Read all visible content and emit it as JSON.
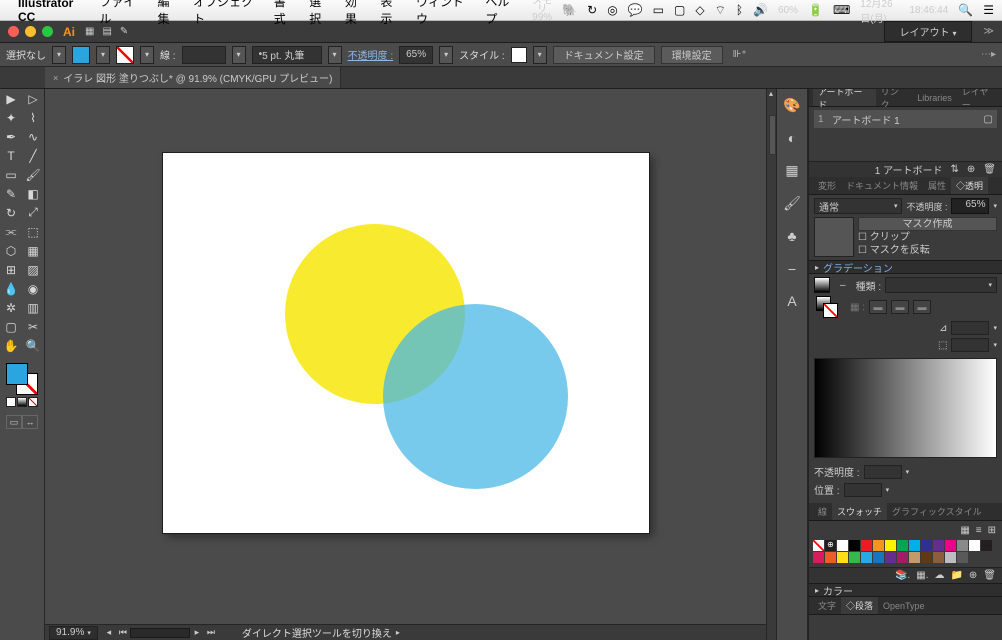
{
  "menubar": {
    "app": "Illustrator CC",
    "items": [
      "ファイル",
      "編集",
      "オブジェクト",
      "書式",
      "選択",
      "効果",
      "表示",
      "ウィンドウ",
      "ヘルプ"
    ],
    "mem_label": "メモリ",
    "mem_pct": "99%",
    "battery": "60%",
    "date": "12月26日(月)",
    "time": "18:46:44"
  },
  "appbar": {
    "layout_label": "レイアウト"
  },
  "controlbar": {
    "no_selection": "選択なし",
    "stroke_label": "線 :",
    "stroke_weight": "5 pt. 丸筆",
    "opacity_label": "不透明度 :",
    "opacity_value": "65%",
    "style_label": "スタイル :",
    "doc_settings": "ドキュメント設定",
    "env_settings": "環境設定"
  },
  "tab": {
    "title": "イラレ 図形 塗りつぶし* @ 91.9% (CMYK/GPU プレビュー)"
  },
  "statusbar": {
    "zoom": "91.9%",
    "tool_hint": "ダイレクト選択ツールを切り換え"
  },
  "panels": {
    "artboard_tabs": [
      "アートボード",
      "リンク",
      "Libraries",
      "レイヤー"
    ],
    "artboard_row": {
      "num": "1",
      "name": "アートボード 1"
    },
    "artboard_count": "1 アートボード",
    "transform_tabs": [
      "変形",
      "ドキュメント情報",
      "属性",
      "◇透明"
    ],
    "blend_mode": "通常",
    "opacity_label": "不透明度 :",
    "opacity_value": "65%",
    "mask_create": "マスク作成",
    "clip": "クリップ",
    "mask_invert": "マスクを反転",
    "gradient_title": "グラデーション",
    "grad_type_label": "種類 :",
    "grad_opacity_label": "不透明度 :",
    "grad_position_label": "位置 :",
    "swatch_tabs": [
      "線",
      "スウォッチ",
      "グラフィックスタイル"
    ],
    "color_title": "カラー",
    "bottom_tabs": [
      "文字",
      "◇段落",
      "OpenType"
    ]
  },
  "swatch_colors": [
    "#ffffff",
    "#000000",
    "#ed1c24",
    "#f7931e",
    "#fff200",
    "#00a651",
    "#00aeef",
    "#2e3192",
    "#662d91",
    "#ec008c",
    "#898989",
    "#ffffff",
    "#231f20",
    "#da1c5c",
    "#f15a29",
    "#ffde17",
    "#39b54a",
    "#27aae1",
    "#1b75bc",
    "#652d90",
    "#9e1f63",
    "#c49a6c",
    "#603913",
    "#8b5e3c",
    "#bcbec0",
    "#58595b"
  ]
}
